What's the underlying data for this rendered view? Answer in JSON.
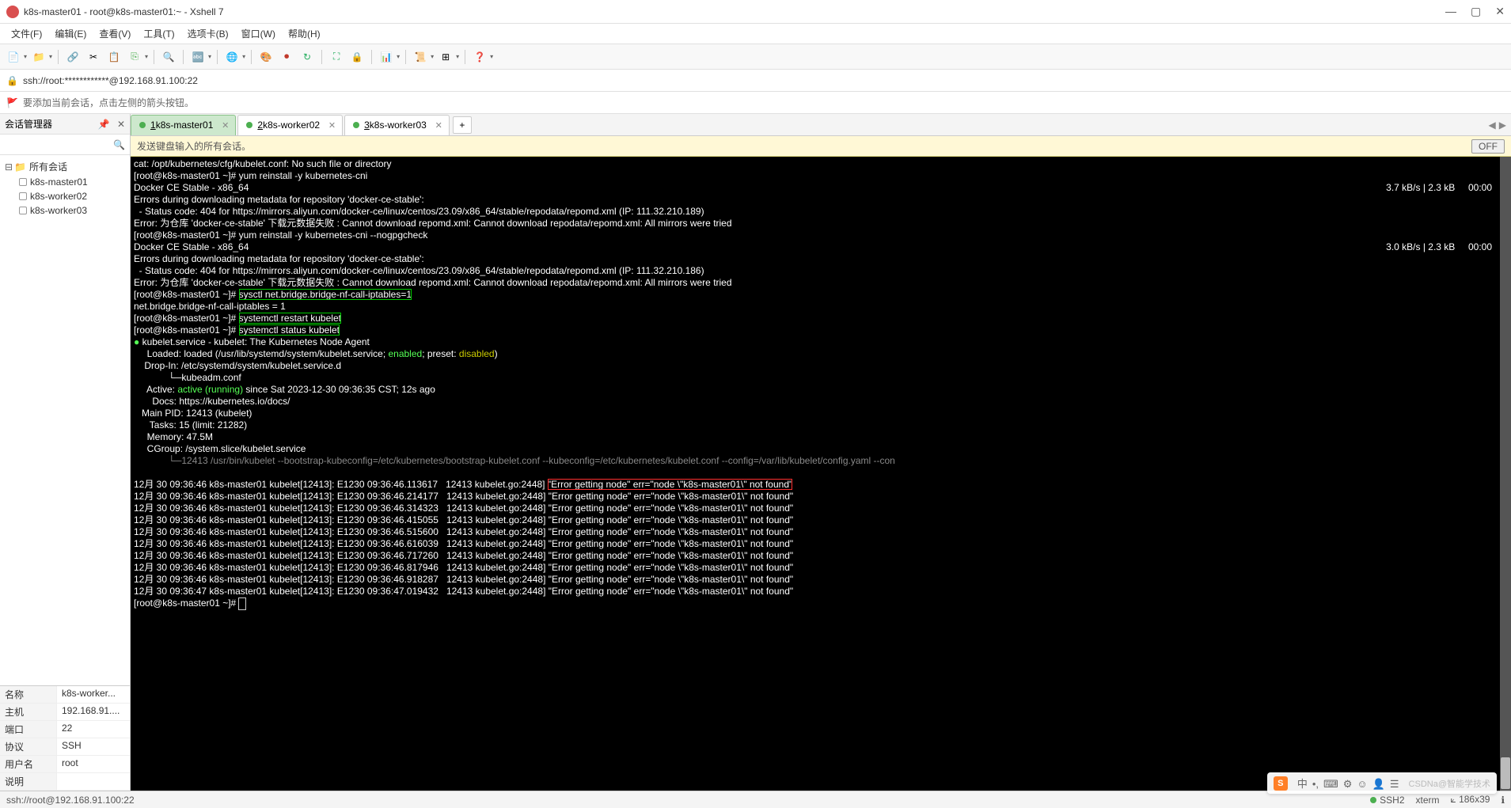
{
  "window": {
    "title": "k8s-master01 - root@k8s-master01:~ - Xshell 7"
  },
  "menu": {
    "items": [
      "文件(F)",
      "编辑(E)",
      "查看(V)",
      "工具(T)",
      "选项卡(B)",
      "窗口(W)",
      "帮助(H)"
    ]
  },
  "address": {
    "text": "ssh://root:************@192.168.91.100:22"
  },
  "infobar": {
    "text": "要添加当前会话，点击左侧的箭头按钮。"
  },
  "sidebar": {
    "title": "会话管理器",
    "root": "所有会话",
    "sessions": [
      "k8s-master01",
      "k8s-worker02",
      "k8s-worker03"
    ]
  },
  "props": {
    "rows": [
      {
        "key": "名称",
        "val": "k8s-worker..."
      },
      {
        "key": "主机",
        "val": "192.168.91...."
      },
      {
        "key": "端口",
        "val": "22"
      },
      {
        "key": "协议",
        "val": "SSH"
      },
      {
        "key": "用户名",
        "val": "root"
      },
      {
        "key": "说明",
        "val": ""
      }
    ]
  },
  "tabs": {
    "items": [
      {
        "num": "1",
        "label": "k8s-master01",
        "active": true
      },
      {
        "num": "2",
        "label": "k8s-worker02",
        "active": false
      },
      {
        "num": "3",
        "label": "k8s-worker03",
        "active": false
      }
    ]
  },
  "broadcast": {
    "text": "发送键盘输入的所有会话。",
    "off": "OFF"
  },
  "terminal": {
    "lines": [
      {
        "t": "plain",
        "text": "cat: /opt/kubernetes/cfg/kubelet.conf: No such file or directory"
      },
      {
        "t": "prompt",
        "prompt": "[root@k8s-master01 ~]# ",
        "cmd": "yum reinstall -y kubernetes-cni"
      },
      {
        "t": "rate",
        "left": "Docker CE Stable - x86_64",
        "right": "3.7 kB/s | 2.3 kB     00:00"
      },
      {
        "t": "plain",
        "text": "Errors during downloading metadata for repository 'docker-ce-stable':"
      },
      {
        "t": "plain",
        "text": "  - Status code: 404 for https://mirrors.aliyun.com/docker-ce/linux/centos/23.09/x86_64/stable/repodata/repomd.xml (IP: 111.32.210.189)"
      },
      {
        "t": "plain",
        "text": "Error: 为仓库 'docker-ce-stable' 下载元数据失败 : Cannot download repomd.xml: Cannot download repodata/repomd.xml: All mirrors were tried"
      },
      {
        "t": "prompt",
        "prompt": "[root@k8s-master01 ~]# ",
        "cmd": "yum reinstall -y kubernetes-cni --nogpgcheck"
      },
      {
        "t": "rate",
        "left": "Docker CE Stable - x86_64",
        "right": "3.0 kB/s | 2.3 kB     00:00"
      },
      {
        "t": "plain",
        "text": "Errors during downloading metadata for repository 'docker-ce-stable':"
      },
      {
        "t": "plain",
        "text": "  - Status code: 404 for https://mirrors.aliyun.com/docker-ce/linux/centos/23.09/x86_64/stable/repodata/repomd.xml (IP: 111.32.210.186)"
      },
      {
        "t": "plain",
        "text": "Error: 为仓库 'docker-ce-stable' 下载元数据失败 : Cannot download repomd.xml: Cannot download repodata/repomd.xml: All mirrors were tried"
      },
      {
        "t": "prompt-box",
        "prompt": "[root@k8s-master01 ~]# ",
        "cmd": "sysctl net.bridge.bridge-nf-call-iptables=1"
      },
      {
        "t": "plain",
        "text": "net.bridge.bridge-nf-call-iptables = 1"
      },
      {
        "t": "prompt-box",
        "prompt": "[root@k8s-master01 ~]# ",
        "cmd": "systemctl restart kubelet"
      },
      {
        "t": "prompt-box",
        "prompt": "[root@k8s-master01 ~]# ",
        "cmd": "systemctl status kubelet"
      },
      {
        "t": "status-head"
      },
      {
        "t": "loaded"
      },
      {
        "t": "dropin",
        "text": "    Drop-In: /etc/systemd/system/kubelet.service.d"
      },
      {
        "t": "dropin2",
        "text": "             └─kubeadm.conf"
      },
      {
        "t": "active"
      },
      {
        "t": "plain",
        "text": "       Docs: https://kubernetes.io/docs/"
      },
      {
        "t": "plain",
        "text": "   Main PID: 12413 (kubelet)"
      },
      {
        "t": "plain",
        "text": "      Tasks: 15 (limit: 21282)"
      },
      {
        "t": "plain",
        "text": "     Memory: 47.5M"
      },
      {
        "t": "plain",
        "text": "     CGroup: /system.slice/kubelet.service"
      },
      {
        "t": "cgroup-line",
        "text": "             └─12413 /usr/bin/kubelet --bootstrap-kubeconfig=/etc/kubernetes/bootstrap-kubelet.conf --kubeconfig=/etc/kubernetes/kubelet.conf --config=/var/lib/kubelet/config.yaml --con"
      },
      {
        "t": "blank"
      },
      {
        "t": "log-red",
        "prefix": "12月 30 09:36:46 k8s-master01 kubelet[12413]: E1230 09:36:46.113617   12413 kubelet.go:2448] ",
        "err": "\"Error getting node\" err=\"node \\\"k8s-master01\\\" not found\""
      },
      {
        "t": "log",
        "text": "12月 30 09:36:46 k8s-master01 kubelet[12413]: E1230 09:36:46.214177   12413 kubelet.go:2448] \"Error getting node\" err=\"node \\\"k8s-master01\\\" not found\""
      },
      {
        "t": "log",
        "text": "12月 30 09:36:46 k8s-master01 kubelet[12413]: E1230 09:36:46.314323   12413 kubelet.go:2448] \"Error getting node\" err=\"node \\\"k8s-master01\\\" not found\""
      },
      {
        "t": "log",
        "text": "12月 30 09:36:46 k8s-master01 kubelet[12413]: E1230 09:36:46.415055   12413 kubelet.go:2448] \"Error getting node\" err=\"node \\\"k8s-master01\\\" not found\""
      },
      {
        "t": "log",
        "text": "12月 30 09:36:46 k8s-master01 kubelet[12413]: E1230 09:36:46.515600   12413 kubelet.go:2448] \"Error getting node\" err=\"node \\\"k8s-master01\\\" not found\""
      },
      {
        "t": "log",
        "text": "12月 30 09:36:46 k8s-master01 kubelet[12413]: E1230 09:36:46.616039   12413 kubelet.go:2448] \"Error getting node\" err=\"node \\\"k8s-master01\\\" not found\""
      },
      {
        "t": "log",
        "text": "12月 30 09:36:46 k8s-master01 kubelet[12413]: E1230 09:36:46.717260   12413 kubelet.go:2448] \"Error getting node\" err=\"node \\\"k8s-master01\\\" not found\""
      },
      {
        "t": "log",
        "text": "12月 30 09:36:46 k8s-master01 kubelet[12413]: E1230 09:36:46.817946   12413 kubelet.go:2448] \"Error getting node\" err=\"node \\\"k8s-master01\\\" not found\""
      },
      {
        "t": "log",
        "text": "12月 30 09:36:46 k8s-master01 kubelet[12413]: E1230 09:36:46.918287   12413 kubelet.go:2448] \"Error getting node\" err=\"node \\\"k8s-master01\\\" not found\""
      },
      {
        "t": "log",
        "text": "12月 30 09:36:47 k8s-master01 kubelet[12413]: E1230 09:36:47.019432   12413 kubelet.go:2448] \"Error getting node\" err=\"node \\\"k8s-master01\\\" not found\""
      },
      {
        "t": "prompt-cursor",
        "prompt": "[root@k8s-master01 ~]# "
      }
    ],
    "status_head": {
      "dot": "●",
      "name": " kubelet.service - kubelet: The Kubernetes Node Agent"
    },
    "loaded": {
      "label": "     Loaded: loaded (/usr/lib/systemd/system/kubelet.service; ",
      "enabled": "enabled",
      "mid": "; preset: ",
      "disabled": "disabled",
      "end": ")"
    },
    "active": {
      "label": "     Active: ",
      "state": "active (running)",
      "rest": " since Sat 2023-12-30 09:36:35 CST; 12s ago"
    }
  },
  "statusbar": {
    "left": "ssh://root@192.168.91.100:22",
    "ssh": "SSH2",
    "term": "xterm",
    "size": "186x39",
    "rows_label": "ℹ"
  },
  "ime": {
    "items": [
      "中",
      "•,",
      "⌨",
      "⚙",
      "☺",
      "👤",
      "☰"
    ],
    "watermark": "CSDNa@智能学技术"
  }
}
